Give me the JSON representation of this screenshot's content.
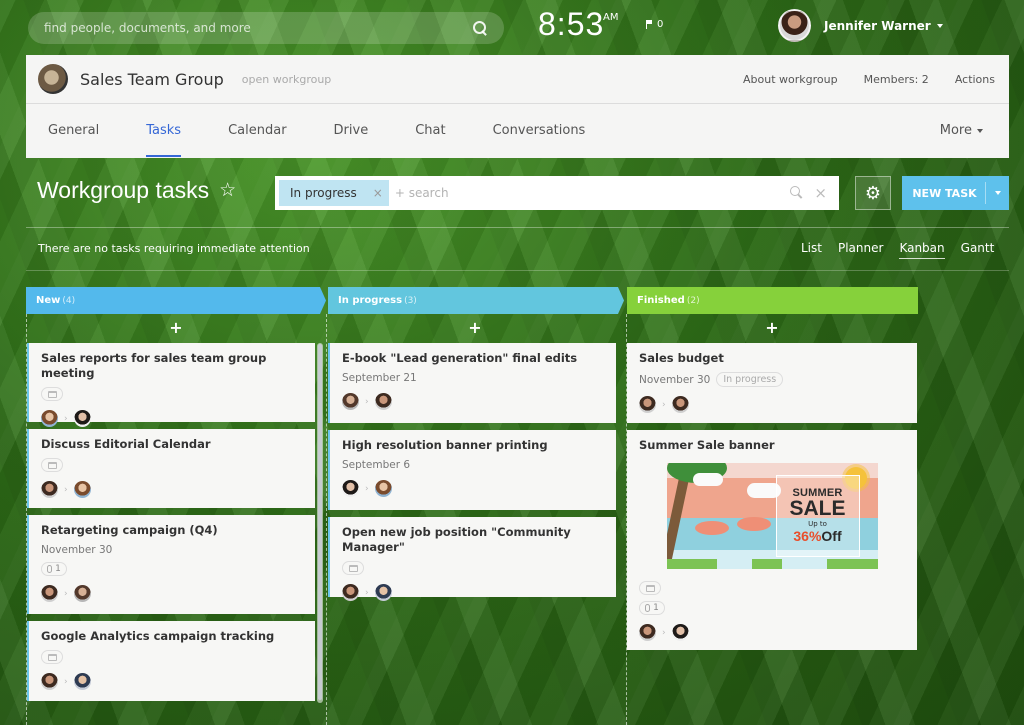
{
  "topbar": {
    "search_placeholder": "find people, documents, and more",
    "time": "8:53",
    "ampm": "AM",
    "notifications_count": "0",
    "user_name": "Jennifer Warner"
  },
  "group": {
    "title": "Sales Team Group",
    "type": "open workgroup",
    "links": [
      "About workgroup",
      "Members: 2",
      "Actions"
    ]
  },
  "tabs": [
    {
      "label": "General",
      "active": false
    },
    {
      "label": "Tasks",
      "active": true
    },
    {
      "label": "Calendar",
      "active": false
    },
    {
      "label": "Drive",
      "active": false
    },
    {
      "label": "Chat",
      "active": false
    },
    {
      "label": "Conversations",
      "active": false
    }
  ],
  "more_label": "More",
  "page": {
    "title": "Workgroup tasks",
    "star": "☆",
    "filter_chip": "In progress",
    "filter_chip_close": "×",
    "search_placeholder": "+ search",
    "clear": "×",
    "settings_icon": "⚙",
    "new_task_label": "NEW TASK",
    "attention_text": "There are no tasks requiring immediate attention",
    "views": [
      "List",
      "Planner",
      "Kanban",
      "Gantt"
    ],
    "active_view": "Kanban"
  },
  "kanban": {
    "add_symbol": "+",
    "arrow": "›",
    "columns": [
      {
        "title": "New",
        "count": "(4)",
        "color": "#53b9ec",
        "tasks": [
          {
            "title": "Sales reports for sales team group meeting",
            "calendar": true
          },
          {
            "title": "Discuss Editorial Calendar",
            "calendar": true
          },
          {
            "title": "Retargeting campaign (Q4)",
            "date": "November 30",
            "attachments": "1"
          },
          {
            "title": "Google Analytics campaign tracking",
            "calendar": true
          }
        ]
      },
      {
        "title": "In progress",
        "count": "(3)",
        "color": "#62c6de",
        "tasks": [
          {
            "title": "E-book \"Lead generation\" final edits",
            "date": "September 21"
          },
          {
            "title": "High resolution banner printing",
            "date": "September 6"
          },
          {
            "title": "Open new job position \"Community Manager\"",
            "calendar": true
          }
        ]
      },
      {
        "title": "Finished",
        "count": "(2)",
        "color": "#86d13b",
        "tasks": [
          {
            "title": "Sales budget",
            "date": "November 30",
            "status": "In progress"
          },
          {
            "title": "Summer Sale banner",
            "calendar": true,
            "attachments": "1",
            "banner": {
              "line1": "SUMMER",
              "line2": "SALE",
              "line3": "Up to",
              "percent": "36%",
              "off": "Off"
            }
          }
        ]
      }
    ]
  }
}
